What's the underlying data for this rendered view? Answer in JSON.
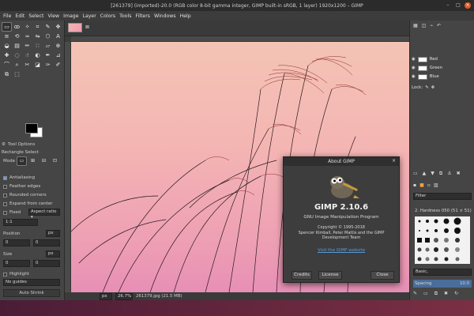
{
  "titlebar": {
    "title": "[261379] (imported)-20.0 (RGB color 8-bit gamma integer, GIMP built-in sRGB, 1 layer) 1920x1200 – GIMP"
  },
  "menu": [
    "File",
    "Edit",
    "Select",
    "View",
    "Image",
    "Layer",
    "Colors",
    "Tools",
    "Filters",
    "Windows",
    "Help"
  ],
  "toolbox": {
    "tool_icons": [
      "rect-select-icon",
      "lasso-icon",
      "fuzzy-select-icon",
      "crop-icon",
      "paintbrush-icon",
      "move-icon",
      "align-icon",
      "transform-icon",
      "warp-icon",
      "flip-icon",
      "cage-icon",
      "text-icon",
      "bucket-icon",
      "gradient-icon",
      "pencil-icon",
      "airbrush-icon",
      "eraser-icon",
      "clone-icon",
      "heal-icon",
      "blur-icon",
      "smudge-icon",
      "dodge-icon",
      "path-icon",
      "picker-icon",
      "measure-icon",
      "zoom-icon",
      "scissors-icon",
      "foreground-select-icon",
      "ink-icon",
      "mypaint-icon",
      "perspective-clone-icon",
      "unified-transform-icon"
    ],
    "tool_options_tab": "Tool Options",
    "panel_title": "Rectangle Select",
    "mode_label": "Mode",
    "antialiasing": "Antialiasing",
    "feather_edges": "Feather edges",
    "rounded_corners": "Rounded corners",
    "expand_from_center": "Expand from center",
    "fixed_label": "Fixed",
    "fixed_value": "Aspect ratio",
    "ratio_value": "1:1",
    "position_label": "Position",
    "position_unit": "px",
    "position_x": "0",
    "position_y": "0",
    "size_label": "Size",
    "size_unit": "px",
    "size_w": "0",
    "size_h": "0",
    "highlight": "Highlight",
    "guides": "No guides",
    "auto_shrink": "Auto Shrink",
    "shrink_merged": "Shrink merged"
  },
  "status": {
    "unit": "px",
    "zoom": "26.7%",
    "file": "261379.jpg (21.5 MB)"
  },
  "layers": {
    "channels": [
      {
        "name": "Red"
      },
      {
        "name": "Green"
      },
      {
        "name": "Blue"
      }
    ],
    "lock_label": "Lock:"
  },
  "brushes": {
    "filter_label": "Filter",
    "brush_name": "2. Hardness 050 (51 × 51)",
    "preset": "Basic,",
    "spacing_label": "Spacing",
    "spacing_value": "10.0"
  },
  "dialog": {
    "title": "About GIMP",
    "version": "GIMP 2.10.6",
    "subtitle": "GNU Image Manipulation Program",
    "copyright": "Copyright © 1995-2018",
    "authors": "Spencer Kimball, Peter Mattis and the GIMP Development Team",
    "link": "Visit the GIMP website",
    "credits": "Credits",
    "license": "License",
    "close": "Close"
  }
}
